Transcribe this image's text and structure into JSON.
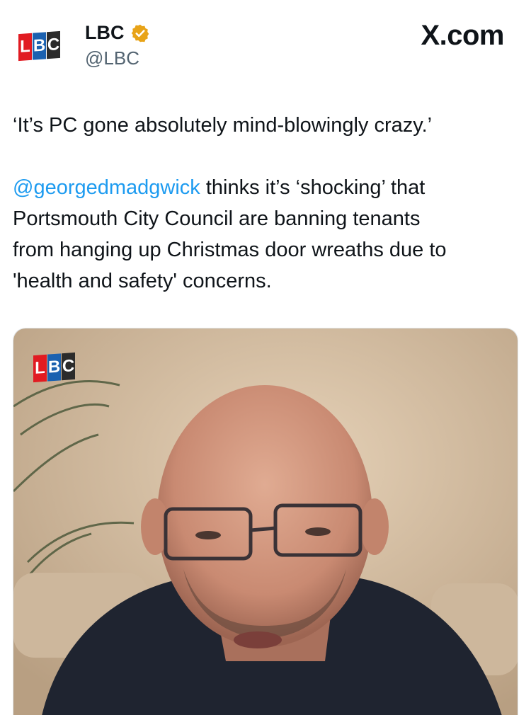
{
  "account": {
    "logo_letters": [
      "L",
      "B",
      "C"
    ],
    "name": "LBC",
    "handle": "@LBC",
    "verified": true,
    "verified_color": "#e8a317"
  },
  "source_watermark": "X.com",
  "tweet": {
    "quote_line": "‘It’s PC gone absolutely mind-blowingly crazy.’",
    "mention": "@georgedmadgwick",
    "body_line_1": " thinks it’s ‘shocking’ that",
    "body_line_2": "Portsmouth City Council are banning tenants",
    "body_line_3": "from hanging up Christmas door wreaths due to",
    "body_line_4": "'health and safety' concerns."
  },
  "media": {
    "type": "video-thumbnail",
    "overlay_logo_letters": [
      "L",
      "B",
      "C"
    ]
  },
  "colors": {
    "mention": "#1d9bf0",
    "lbc_red": "#e11b22",
    "lbc_blue": "#1b61b0",
    "lbc_dark": "#2b2b2b"
  }
}
